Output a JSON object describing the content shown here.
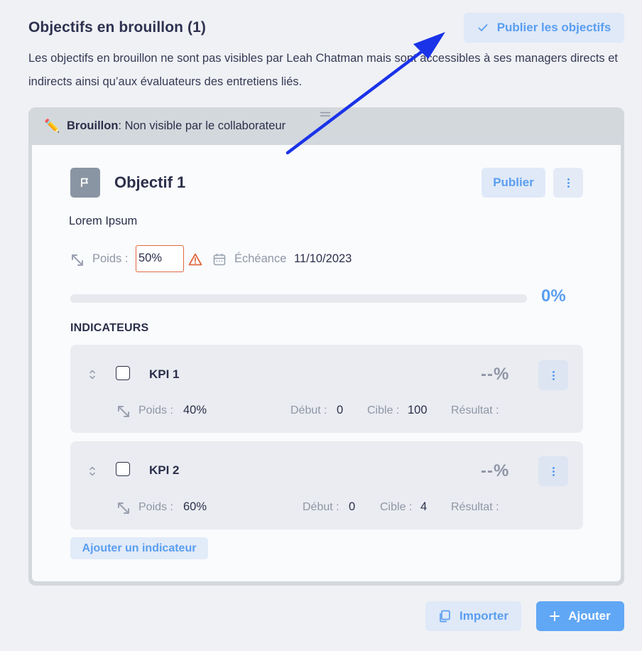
{
  "section": {
    "title": "Objectifs en brouillon (1)",
    "description": "Les objectifs en brouillon ne sont pas visibles par Leah Chatman mais sont accessibles à ses managers directs et indirects ainsi qu’aux évaluateurs des entretiens liés.",
    "publish_all_label": "Publier les objectifs"
  },
  "draft": {
    "banner_bold": "Brouillon",
    "banner_text": ": Non visible par le collaborateur"
  },
  "objective": {
    "title": "Objectif 1",
    "publish_label": "Publier",
    "description": "Lorem Ipsum",
    "weight_label": "Poids :",
    "weight_value": "50%",
    "deadline_label": "Échéance",
    "deadline_value": "11/10/2023",
    "progress_pct": "0%",
    "progress_fraction": 0
  },
  "indicators": {
    "title": "INDICATEURS",
    "add_label": "Ajouter un indicateur",
    "items": [
      {
        "name": "KPI 1",
        "pct": "--%",
        "weight_label": "Poids :",
        "weight": "40%",
        "start_label": "Début :",
        "start": "0",
        "target_label": "Cible :",
        "target": "100",
        "result_label": "Résultat :"
      },
      {
        "name": "KPI 2",
        "pct": "--%",
        "weight_label": "Poids :",
        "weight": "60%",
        "start_label": "Début :",
        "start": "0",
        "target_label": "Cible :",
        "target": "4",
        "result_label": "Résultat :"
      }
    ]
  },
  "footer": {
    "import_label": "Importer",
    "add_label": "Ajouter"
  },
  "colors": {
    "accent": "#5a9ef0",
    "warning": "#e0693f",
    "annotation_arrow": "#1a33e8"
  }
}
